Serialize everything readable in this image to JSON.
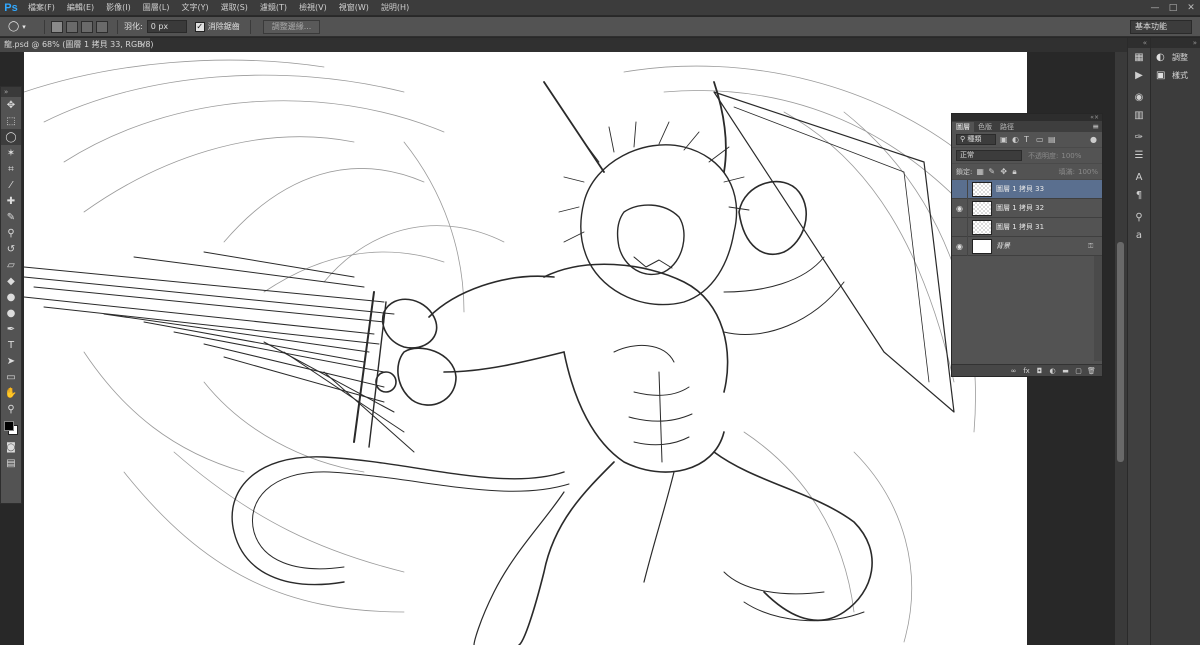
{
  "app": {
    "logo": "Ps",
    "menu": [
      "檔案(F)",
      "編輯(E)",
      "影像(I)",
      "圖層(L)",
      "文字(Y)",
      "選取(S)",
      "濾鏡(T)",
      "檢視(V)",
      "視窗(W)",
      "說明(H)"
    ],
    "window_controls": [
      "—",
      "□",
      "✕"
    ]
  },
  "options_bar": {
    "tool_icon": "lasso-icon",
    "feather_label": "羽化:",
    "feather_value": "0 px",
    "antialias_checked": true,
    "antialias_label": "消除鋸齒",
    "refine_edge_label": "調整邊緣...",
    "workspace": "基本功能"
  },
  "document": {
    "tab_title": "龍.psd @ 68% (圖層 1 拷貝 33, RGB/8)",
    "zoom": "68%"
  },
  "dock": {
    "labels": [
      {
        "icon": "adjustments-icon",
        "glyph": "◐",
        "label": "調整"
      },
      {
        "icon": "styles-icon",
        "glyph": "▣",
        "label": "樣式"
      }
    ]
  },
  "layers_panel": {
    "tabs": [
      "圖層",
      "色版",
      "路徑"
    ],
    "active_tab": "圖層",
    "filter_kind": "種類",
    "blend_mode": "正常",
    "opacity_label": "不透明度:",
    "opacity_value": "100%",
    "lock_label": "鎖定:",
    "fill_label": "填滿:",
    "fill_value": "100%",
    "layers": [
      {
        "name": "圖層 1 拷貝 33",
        "visible": false,
        "selected": true,
        "thumb": "transparent",
        "locked": false
      },
      {
        "name": "圖層 1 拷貝 32",
        "visible": true,
        "selected": false,
        "thumb": "transparent",
        "locked": false
      },
      {
        "name": "圖層 1 拷貝 31",
        "visible": false,
        "selected": false,
        "thumb": "transparent",
        "locked": false
      },
      {
        "name": "背景",
        "visible": true,
        "selected": false,
        "thumb": "white",
        "locked": true
      }
    ],
    "bottom_icons": [
      "link-icon",
      "fx-icon",
      "mask-icon",
      "adjustment-layer-icon",
      "group-icon",
      "new-layer-icon",
      "trash-icon"
    ]
  }
}
